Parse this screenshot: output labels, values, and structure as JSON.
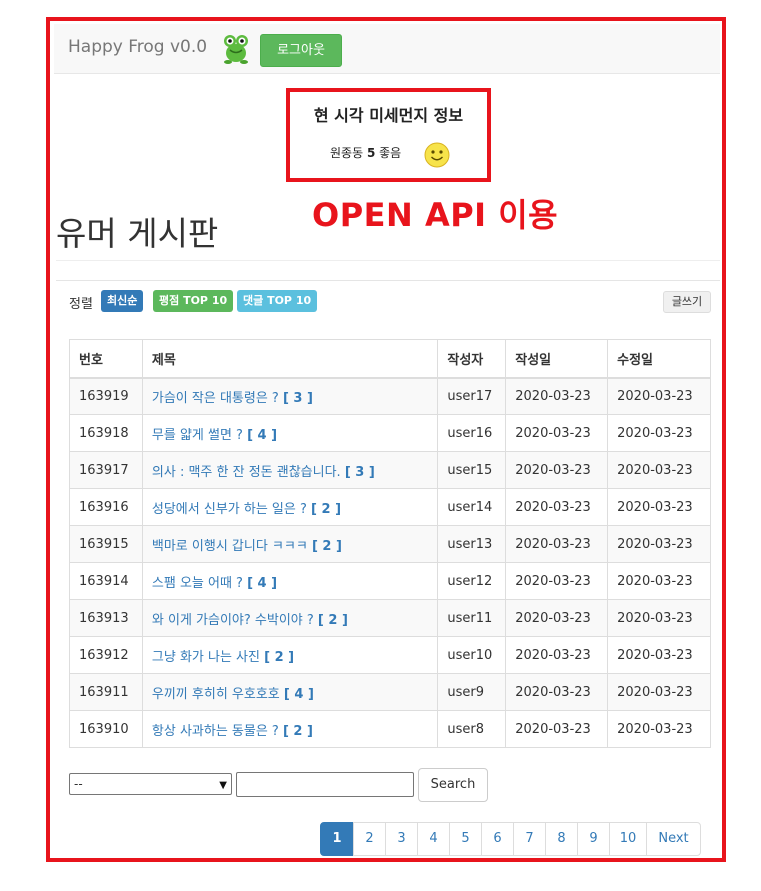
{
  "navbar": {
    "brand": "Happy Frog v0.0",
    "logout_label": "로그아웃"
  },
  "dust": {
    "title": "현 시각 미세먼지 정보",
    "location": "원종동",
    "value": "5",
    "grade": "좋음"
  },
  "annotation": "OPEN API 이용",
  "page_title": "유머 게시판",
  "sort": {
    "label": "정렬",
    "options": [
      "최신순",
      "평점 TOP 10",
      "댓글 TOP 10"
    ],
    "write_label": "글쓰기"
  },
  "table": {
    "headers": [
      "번호",
      "제목",
      "작성자",
      "작성일",
      "수정일"
    ],
    "rows": [
      {
        "num": "163919",
        "title": "가슴이 작은 대통령은 ?",
        "count": "[ 3 ]",
        "author": "user17",
        "created": "2020-03-23",
        "updated": "2020-03-23"
      },
      {
        "num": "163918",
        "title": "무를 얇게 썰면 ?",
        "count": "[ 4 ]",
        "author": "user16",
        "created": "2020-03-23",
        "updated": "2020-03-23"
      },
      {
        "num": "163917",
        "title": "의사 : 맥주 한 잔 정돈 괜찮습니다.",
        "count": "[ 3 ]",
        "author": "user15",
        "created": "2020-03-23",
        "updated": "2020-03-23"
      },
      {
        "num": "163916",
        "title": "성당에서 신부가 하는 일은 ?",
        "count": "[ 2 ]",
        "author": "user14",
        "created": "2020-03-23",
        "updated": "2020-03-23"
      },
      {
        "num": "163915",
        "title": "백마로 이행시 갑니다 ㅋㅋㅋ",
        "count": "[ 2 ]",
        "author": "user13",
        "created": "2020-03-23",
        "updated": "2020-03-23"
      },
      {
        "num": "163914",
        "title": "스팸 오늘 어때 ?",
        "count": "[ 4 ]",
        "author": "user12",
        "created": "2020-03-23",
        "updated": "2020-03-23"
      },
      {
        "num": "163913",
        "title": "와 이게 가슴이야? 수박이야 ?",
        "count": "[ 2 ]",
        "author": "user11",
        "created": "2020-03-23",
        "updated": "2020-03-23"
      },
      {
        "num": "163912",
        "title": "그냥 화가 나는 사진",
        "count": "[ 2 ]",
        "author": "user10",
        "created": "2020-03-23",
        "updated": "2020-03-23"
      },
      {
        "num": "163911",
        "title": "우끼끼 후히히 우호호호",
        "count": "[ 4 ]",
        "author": "user9",
        "created": "2020-03-23",
        "updated": "2020-03-23"
      },
      {
        "num": "163910",
        "title": "항상 사과하는 동물은 ?",
        "count": "[ 2 ]",
        "author": "user8",
        "created": "2020-03-23",
        "updated": "2020-03-23"
      }
    ]
  },
  "search": {
    "select_value": "--",
    "input_value": "",
    "button_label": "Search"
  },
  "pagination": {
    "pages": [
      "1",
      "2",
      "3",
      "4",
      "5",
      "6",
      "7",
      "8",
      "9",
      "10"
    ],
    "active": "1",
    "next_label": "Next"
  },
  "colors": {
    "annotation_red": "#e8141c",
    "primary": "#337ab7",
    "success": "#5cb85c",
    "info": "#5bc0de"
  }
}
